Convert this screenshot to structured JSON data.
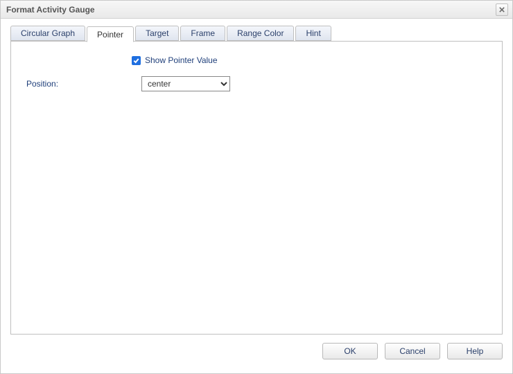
{
  "dialog": {
    "title": "Format Activity Gauge"
  },
  "tabs": {
    "items": [
      {
        "label": "Circular Graph",
        "active": false
      },
      {
        "label": "Pointer",
        "active": true
      },
      {
        "label": "Target",
        "active": false
      },
      {
        "label": "Frame",
        "active": false
      },
      {
        "label": "Range Color",
        "active": false
      },
      {
        "label": "Hint",
        "active": false
      }
    ]
  },
  "pointer_panel": {
    "show_pointer_value_label": "Show Pointer Value",
    "show_pointer_value_checked": true,
    "position_label": "Position:",
    "position_value": "center"
  },
  "buttons": {
    "ok": "OK",
    "cancel": "Cancel",
    "help": "Help"
  }
}
